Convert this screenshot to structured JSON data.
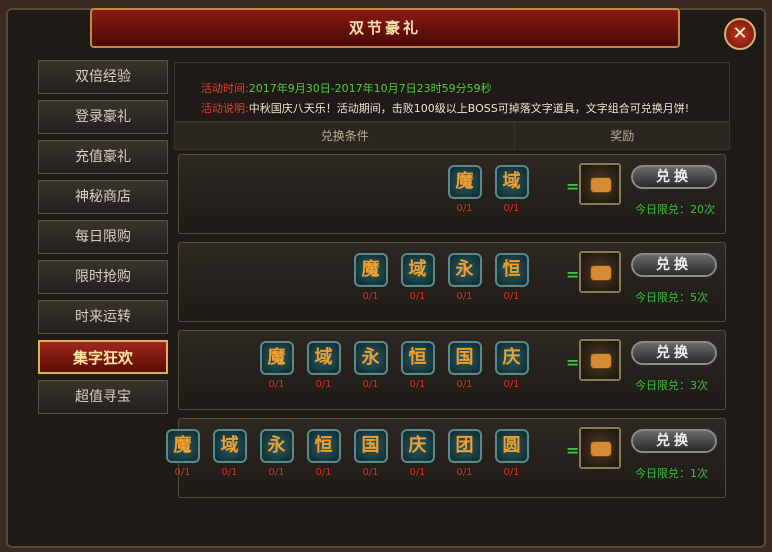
{
  "title": "双节豪礼",
  "close_label": "✕",
  "sidebar": {
    "items": [
      {
        "label": "双倍经验",
        "active": false
      },
      {
        "label": "登录豪礼",
        "active": false
      },
      {
        "label": "充值豪礼",
        "active": false
      },
      {
        "label": "神秘商店",
        "active": false
      },
      {
        "label": "每日限购",
        "active": false
      },
      {
        "label": "限时抢购",
        "active": false
      },
      {
        "label": "时来运转",
        "active": false
      },
      {
        "label": "集字狂欢",
        "active": true
      },
      {
        "label": "超值寻宝",
        "active": false
      }
    ]
  },
  "info": {
    "time_label": "活动时间:",
    "time_value": "2017年9月30日-2017年10月7日23时59分59秒",
    "desc_label": "活动说明:",
    "desc_value": "中秋国庆八天乐！活动期间，击败100级以上BOSS可掉落文字道具，文字组合可兑换月饼!"
  },
  "table": {
    "col_condition": "兑换条件",
    "col_reward": "奖励"
  },
  "rows": [
    {
      "chars": [
        "魔",
        "域"
      ],
      "counts": [
        "0/1",
        "0/1"
      ],
      "button": "兑换",
      "limit": "今日限兑：20次"
    },
    {
      "chars": [
        "魔",
        "域",
        "永",
        "恒"
      ],
      "counts": [
        "0/1",
        "0/1",
        "0/1",
        "0/1"
      ],
      "button": "兑换",
      "limit": "今日限兑：5次"
    },
    {
      "chars": [
        "魔",
        "域",
        "永",
        "恒",
        "国",
        "庆"
      ],
      "counts": [
        "0/1",
        "0/1",
        "0/1",
        "0/1",
        "0/1",
        "0/1"
      ],
      "button": "兑换",
      "limit": "今日限兑：3次"
    },
    {
      "chars": [
        "魔",
        "域",
        "永",
        "恒",
        "国",
        "庆",
        "团",
        "圆"
      ],
      "counts": [
        "0/1",
        "0/1",
        "0/1",
        "0/1",
        "0/1",
        "0/1",
        "0/1",
        "0/1"
      ],
      "button": "兑换",
      "limit": "今日限兑：1次"
    }
  ],
  "equals_sign": "="
}
